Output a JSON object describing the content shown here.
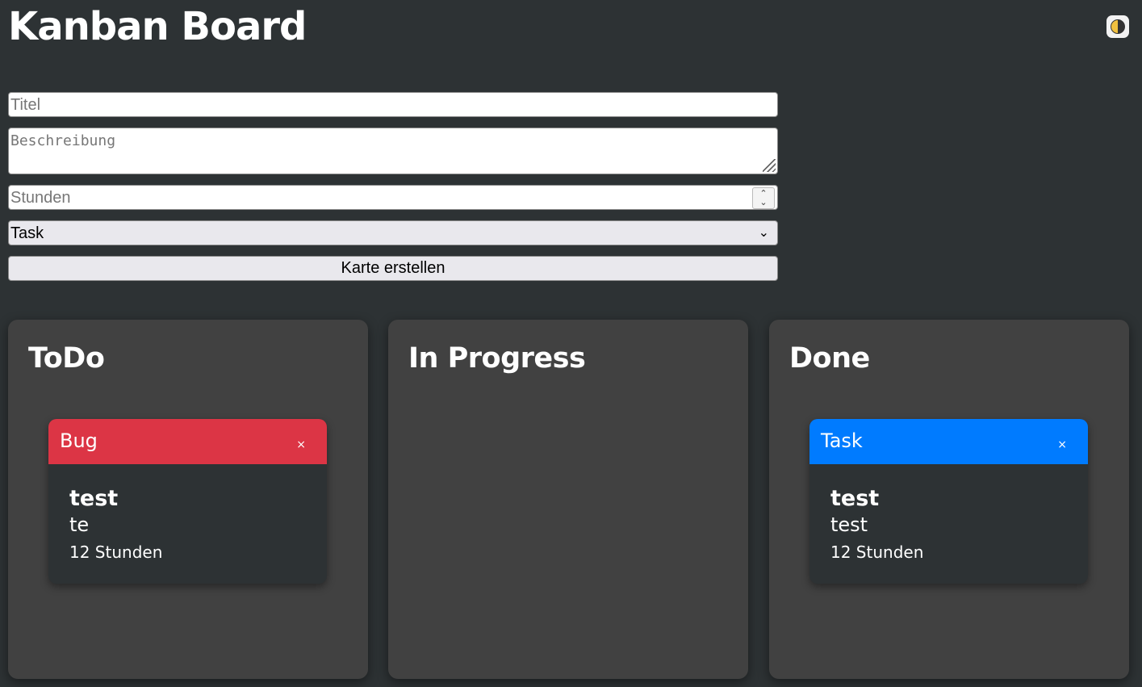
{
  "header": {
    "title": "Kanban Board",
    "theme_toggle_icon": "half-circle-icon"
  },
  "form": {
    "title_placeholder": "Titel",
    "description_placeholder": "Beschreibung",
    "hours_placeholder": "Stunden",
    "type_selected": "Task",
    "submit_label": "Karte erstellen"
  },
  "columns": [
    {
      "title": "ToDo",
      "cards": [
        {
          "type": "Bug",
          "type_color": "#dc3545",
          "title": "test",
          "description": "te",
          "hours": "12 Stunden",
          "close": "×"
        }
      ]
    },
    {
      "title": "In Progress",
      "cards": []
    },
    {
      "title": "Done",
      "cards": [
        {
          "type": "Task",
          "type_color": "#007bff",
          "title": "test",
          "description": "test",
          "hours": "12 Stunden",
          "close": "×"
        }
      ]
    }
  ]
}
